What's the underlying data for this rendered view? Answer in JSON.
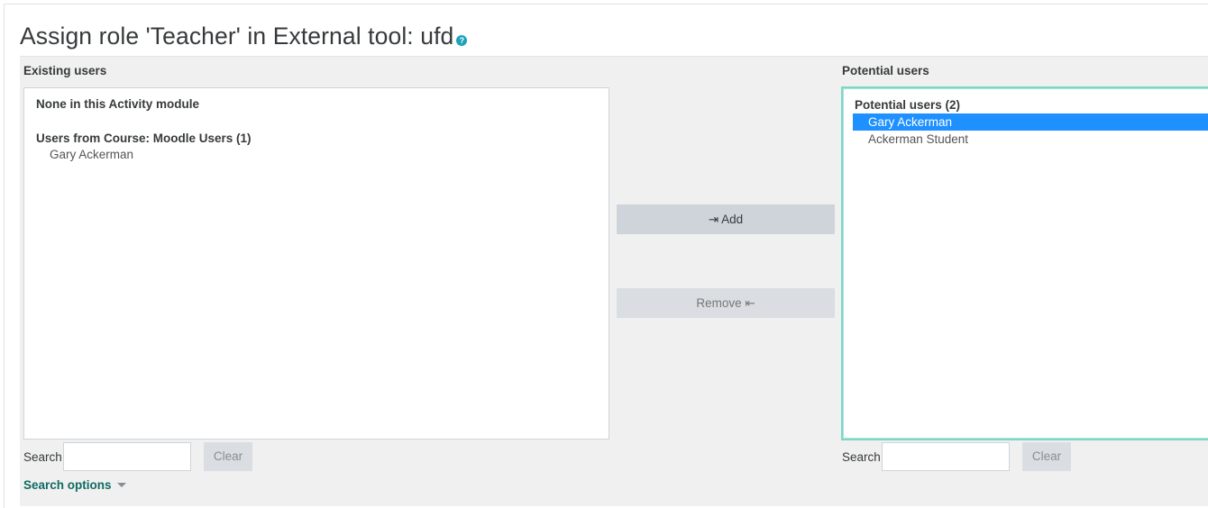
{
  "page": {
    "title": "Assign role 'Teacher' in External tool: ufd",
    "help_icon": "?"
  },
  "existing": {
    "label": "Existing users",
    "groups": [
      {
        "label": "None in this Activity module",
        "options": []
      },
      {
        "label": "Users from Course: Moodle Users (1)",
        "options": [
          "Gary Ackerman"
        ]
      }
    ],
    "search_label": "Search",
    "search_value": "",
    "clear_label": "Clear"
  },
  "actions": {
    "add_label": "⇥ Add",
    "remove_label": "Remove ⇤"
  },
  "potential": {
    "label": "Potential users",
    "group_label": "Potential users (2)",
    "options": [
      "Gary Ackerman",
      "Ackerman Student"
    ],
    "selected_index": 0,
    "search_label": "Search",
    "search_value": "",
    "clear_label": "Clear"
  },
  "search_options": {
    "label": "Search options",
    "icon": "caret-down-icon"
  },
  "colors": {
    "selected_bg": "#1e90ff",
    "focus_border": "#7fd6c6",
    "link": "#0f6a63",
    "help_icon": "#1ba2b8"
  }
}
